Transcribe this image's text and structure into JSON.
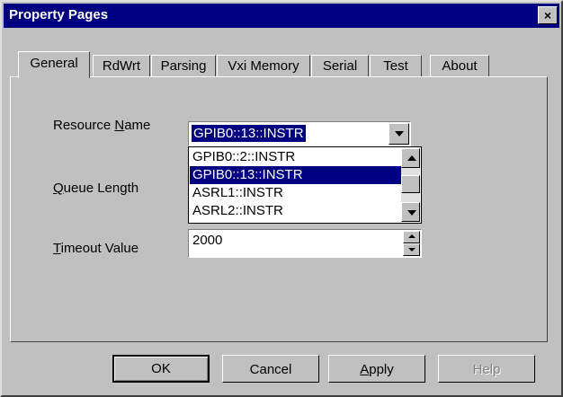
{
  "window": {
    "title": "Property Pages",
    "close_glyph": "×"
  },
  "tabs": [
    {
      "label": "General",
      "active": true
    },
    {
      "label": "RdWrt",
      "active": false
    },
    {
      "label": "Parsing",
      "active": false
    },
    {
      "label": "Vxi Memory",
      "active": false
    },
    {
      "label": "Serial",
      "active": false
    },
    {
      "label": "Test",
      "active": false
    },
    {
      "label": "About",
      "active": false
    }
  ],
  "form": {
    "resource_name": {
      "label_pre": "Resource ",
      "label_accel": "N",
      "label_post": "ame",
      "value": "GPIB0::13::INSTR",
      "options": [
        "GPIB0::2::INSTR",
        "GPIB0::13::INSTR",
        "ASRL1::INSTR",
        "ASRL2::INSTR"
      ],
      "selected_index": 1
    },
    "queue_length": {
      "label_accel": "Q",
      "label_post": "ueue Length"
    },
    "timeout": {
      "label_accel": "T",
      "label_post": "imeout Value",
      "value": "2000"
    }
  },
  "buttons": {
    "ok": "OK",
    "cancel": "Cancel",
    "apply_accel": "A",
    "apply_post": "pply",
    "help": "Help"
  },
  "colors": {
    "titlebar": "#000080",
    "selection": "#000080",
    "face": "#c0c0c0"
  }
}
